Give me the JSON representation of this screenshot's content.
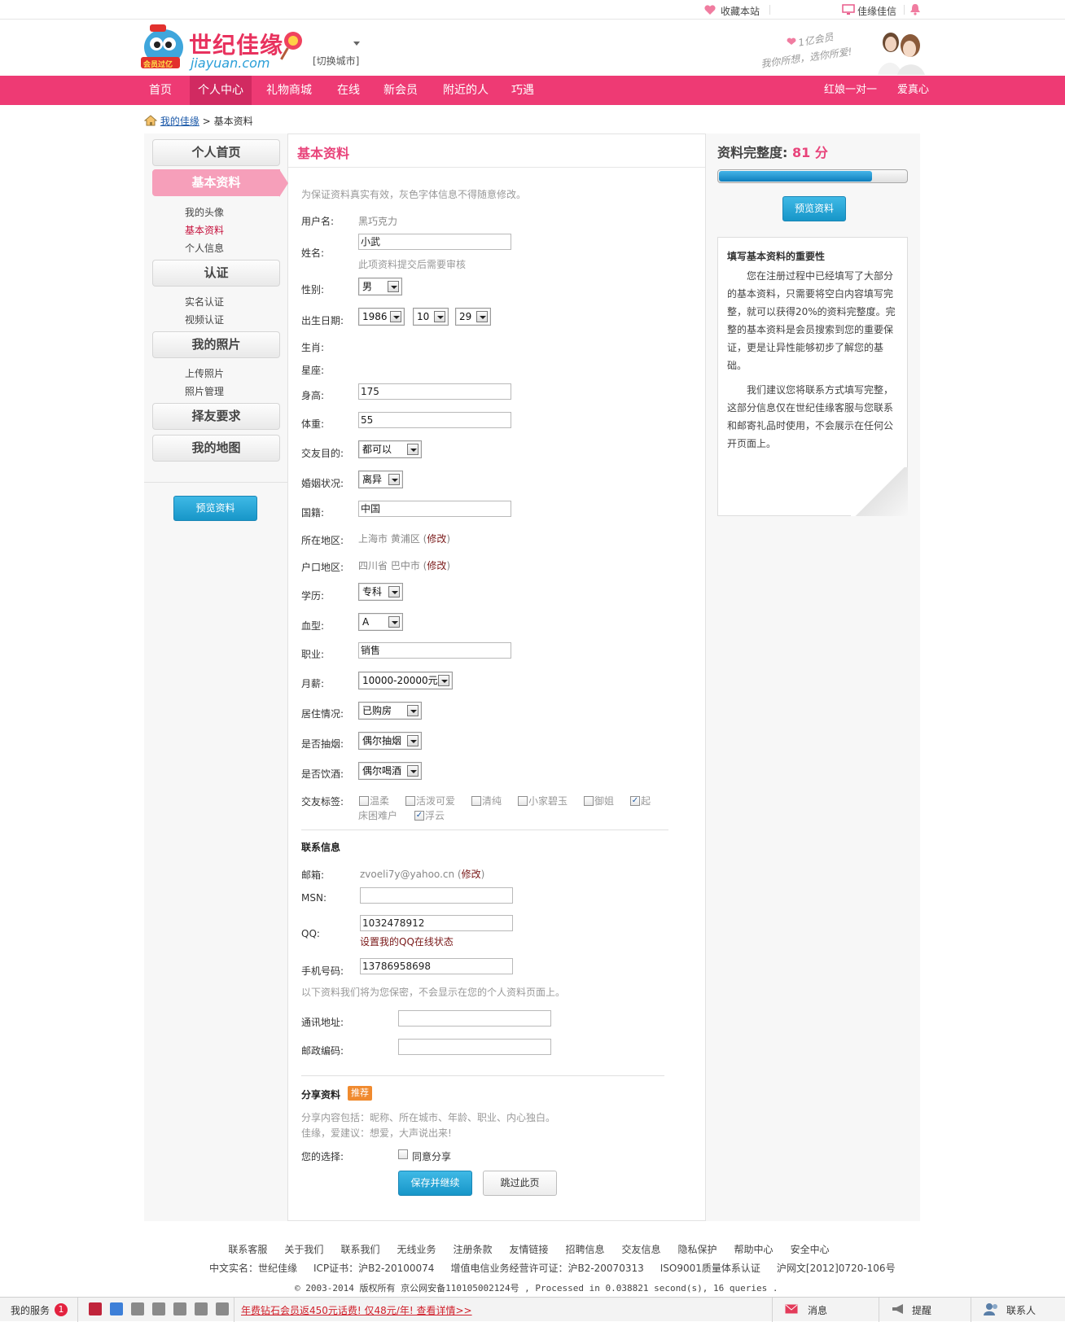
{
  "topbar": {
    "bookmark": "收藏本站",
    "mail": "佳缘佳信"
  },
  "header": {
    "logo_text": "世纪佳缘",
    "logo_domain": "jiayuan.com",
    "logo_badge": "会员过亿",
    "switch_city": "[切换城市]",
    "slogan_line1": "1亿会员",
    "slogan_line2": "我你所想，选你所爱!"
  },
  "nav": {
    "items": [
      "首页",
      "个人中心",
      "礼物商城",
      "在线",
      "新会员",
      "附近的人",
      "巧遇"
    ],
    "right": [
      "红娘一对一",
      "爱真心"
    ]
  },
  "breadcrumb": {
    "home": "我的佳缘",
    "sep": ">",
    "current": "基本资料"
  },
  "sidebar": {
    "buttons": [
      "个人首页",
      "基本资料",
      "认证",
      "我的照片",
      "择友要求",
      "我的地图"
    ],
    "sub_basic": [
      "我的头像",
      "基本资料",
      "个人信息"
    ],
    "sub_auth": [
      "实名认证",
      "视频认证"
    ],
    "sub_photos": [
      "上传照片",
      "照片管理"
    ],
    "preview": "预览资料"
  },
  "main": {
    "title": "基本资料",
    "hint": "为保证资料真实有效，灰色字体信息不得随意修改。",
    "labels": {
      "username": "用户名:",
      "name": "姓名:",
      "gender": "性别:",
      "birthday": "出生日期:",
      "zodiac": "生肖:",
      "constellation": "星座:",
      "height": "身高:",
      "weight": "体重:",
      "purpose": "交友目的:",
      "marital": "婚姻状况:",
      "nationality": "国籍:",
      "location": "所在地区:",
      "hukou": "户口地区:",
      "education": "学历:",
      "blood": "血型:",
      "job": "职业:",
      "salary": "月薪:",
      "housing": "居住情况:",
      "smoke": "是否抽烟:",
      "drink": "是否饮酒:",
      "tags": "交友标签:"
    },
    "values": {
      "username": "黑巧克力",
      "name": "小武",
      "name_note": "此项资料提交后需要审核",
      "gender": "男",
      "birth_year": "1986",
      "birth_month": "10",
      "birth_day": "29",
      "height": "175",
      "weight": "55",
      "purpose": "都可以",
      "marital": "离异",
      "nationality": "中国",
      "location": "上海市 黄浦区",
      "hukou": "四川省 巴中市",
      "education": "专科",
      "blood": "A",
      "job": "销售",
      "salary": "10000-20000元",
      "housing": "已购房",
      "smoke": "偶尔抽烟",
      "drink": "偶尔喝酒",
      "edit": "修改",
      "paren_open": "(",
      "paren_close": ")"
    },
    "tags": [
      {
        "label": "温柔",
        "checked": false
      },
      {
        "label": "活泼可爱",
        "checked": false
      },
      {
        "label": "清纯",
        "checked": false
      },
      {
        "label": "小家碧玉",
        "checked": false
      },
      {
        "label": "御姐",
        "checked": false
      },
      {
        "label": "起床困难户",
        "checked": true
      },
      {
        "label": "浮云",
        "checked": true
      }
    ],
    "tag_split": {
      "a": "起",
      "b": "床困难户"
    },
    "contact": {
      "title": "联系信息",
      "email_label": "邮箱:",
      "email": "zvoeli7y@yahoo.cn",
      "msn_label": "MSN:",
      "msn": "",
      "qq_label": "QQ:",
      "qq": "1032478912",
      "qq_link": "设置我的QQ在线状态",
      "mobile_label": "手机号码:",
      "mobile": "13786958698",
      "privacy_note": "以下资料我们将为您保密，不会显示在您的个人资料页面上。",
      "address_label": "通讯地址:",
      "address": "",
      "zip_label": "邮政编码:",
      "zip": ""
    },
    "share": {
      "title": "分享资料",
      "badge": "推荐",
      "desc1": "分享内容包括：昵称、所在城市、年龄、职业、内心独白。",
      "desc2": "佳缘，爱建议：想爱，大声说出来!",
      "choice_label": "您的选择:",
      "agree": "同意分享"
    },
    "save_button": "保存并继续",
    "skip_button": "跳过此页"
  },
  "right": {
    "score_label": "资料完整度:",
    "score": "81 分",
    "score_value": 81,
    "preview": "预览资料",
    "tip_title": "填写基本资料的重要性",
    "tip_p1": "您在注册过程中已经填写了大部分的基本资料，只需要将空白内容填写完整，就可以获得20%的资料完整度。完整的基本资料是会员搜索到您的重要保证，更是让异性能够初步了解您的基础。",
    "tip_p2": "我们建议您将联系方式填写完整，这部分信息仅在世纪佳缘客服与您联系和邮寄礼品时使用，不会展示在任何公开页面上。"
  },
  "footer": {
    "links": [
      "联系客服",
      "关于我们",
      "联系我们",
      "无线业务",
      "注册条款",
      "友情链接",
      "招聘信息",
      "交友信息",
      "隐私保护",
      "帮助中心",
      "安全中心"
    ],
    "line2": [
      "中文实名：世纪佳缘",
      "ICP证书：沪B2-20100074",
      "增值电信业务经营许可证：沪B2-20070313",
      "ISO9001质量体系认证",
      "沪网文[2012]0720-106号"
    ],
    "line3": "© 2003-2014 版权所有 京公网安备110105002124号 , Processed in 0.038821 second(s), 16 queries ."
  },
  "bottombar": {
    "service": "我的服务",
    "badge": "1",
    "promo": "年费钻石会员返450元话费! 仅48元/年! 查看详情>>",
    "messages": "消息",
    "remind": "提醒",
    "contacts": "联系人"
  },
  "colors": {
    "brand_pink": "#ee3a74",
    "active_pink": "#d12a61",
    "title_pink": "#e8437a",
    "btn_blue": "#1796c8"
  }
}
